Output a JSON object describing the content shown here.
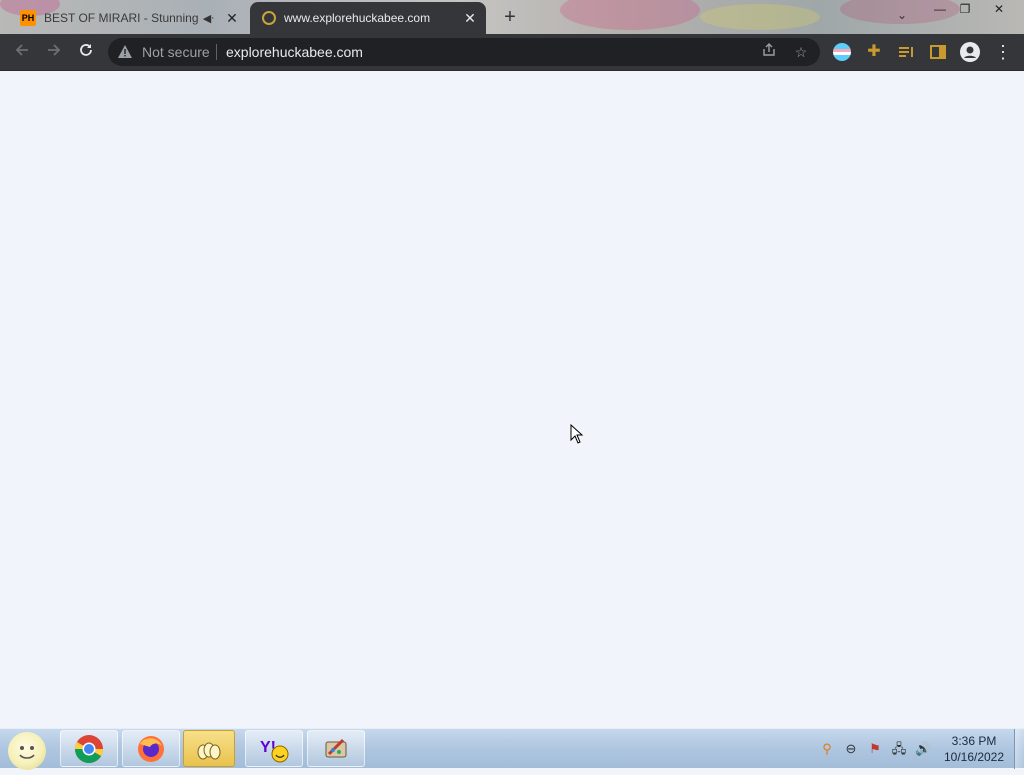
{
  "browser": {
    "tabs": [
      {
        "favicon": "PH",
        "title": "BEST OF MIRARI - Stunning",
        "audio_icon": "speaker-muted-icon",
        "active": false
      },
      {
        "favicon": "globe-loading-icon",
        "title": "www.explorehuckabee.com",
        "active": true
      }
    ],
    "security_label": "Not secure",
    "url": "explorehuckabee.com",
    "toolbar_icons": [
      "back-arrow-icon",
      "forward-arrow-icon",
      "reload-icon",
      "share-icon",
      "bookmark-star-icon",
      "extension-icon",
      "puzzle-extensions-icon",
      "media-queue-icon",
      "side-panel-icon",
      "profile-avatar-icon",
      "menu-kebab-icon"
    ],
    "window_controls": [
      "minimize",
      "restore",
      "close"
    ]
  },
  "taskbar": {
    "apps": [
      "chrome-icon",
      "firefox-icon",
      "folder-eggs-icon",
      "yahoo-messenger-icon",
      "paint-icon"
    ],
    "clock": {
      "time": "3:36 PM",
      "date": "10/16/2022"
    },
    "tray_icons": [
      "search-magnifier-icon",
      "minus-circle-icon",
      "flag-error-icon",
      "network-icon",
      "volume-icon"
    ]
  },
  "colors": {
    "tab_strip_dark": "#35363a",
    "omnibox_bg": "#202124",
    "page_bg": "#f1f5fb",
    "taskbar": "#aec6e0"
  }
}
